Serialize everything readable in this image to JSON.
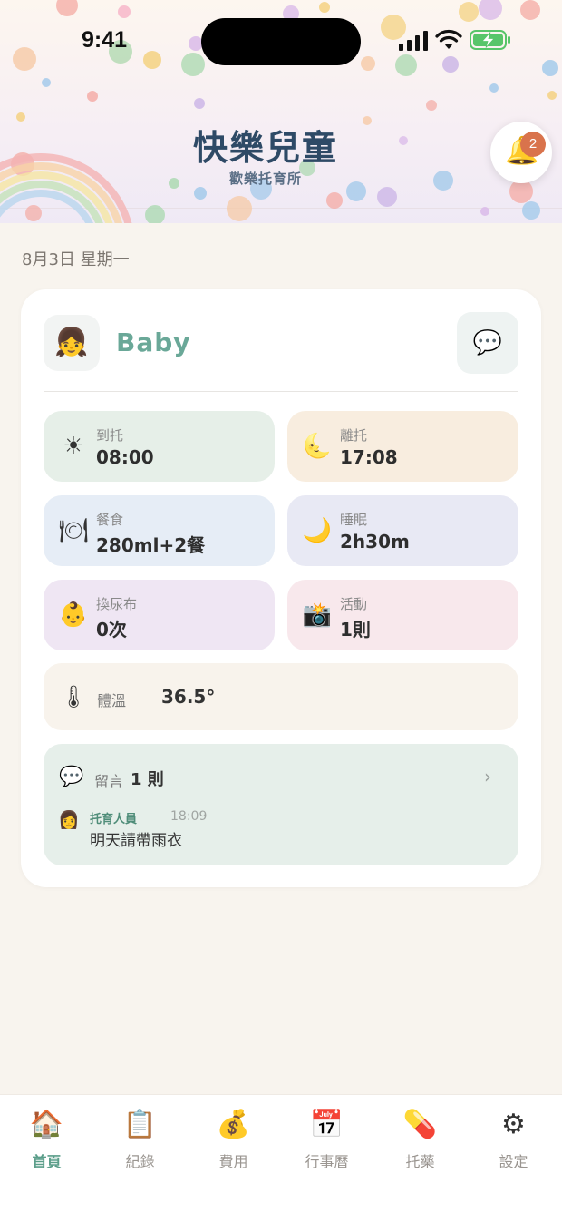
{
  "status_bar": {
    "time": "9:41"
  },
  "header": {
    "title": "快樂兒童",
    "subtitle": "歡樂托育所",
    "notification_count": "2"
  },
  "date": "8月3日 星期一",
  "child": {
    "name": "Baby"
  },
  "tiles": [
    {
      "label": "到托",
      "value": "08:00",
      "icon": "sun-icon"
    },
    {
      "label": "離托",
      "value": "17:08",
      "icon": "moon-face-icon"
    },
    {
      "label": "餐食",
      "value": "280ml+2餐",
      "icon": "plate-icon"
    },
    {
      "label": "睡眠",
      "value": "2h30m",
      "icon": "crescent-moon-icon"
    },
    {
      "label": "換尿布",
      "value": "0次",
      "icon": "baby-icon"
    },
    {
      "label": "活動",
      "value": "1則",
      "icon": "camera-flash-icon"
    }
  ],
  "temperature": {
    "label": "體溫",
    "value": "36.5°",
    "icon": "thermometer-icon"
  },
  "messages": {
    "label": "留言",
    "count": "1 則",
    "latest": {
      "author": "托育人員",
      "time": "18:09",
      "text": "明天請帶雨衣"
    }
  },
  "tabbar": [
    {
      "label": "首頁",
      "icon": "house-icon",
      "active": true
    },
    {
      "label": "紀錄",
      "icon": "clipboard-icon",
      "active": false
    },
    {
      "label": "費用",
      "icon": "money-bag-icon",
      "active": false
    },
    {
      "label": "行事曆",
      "icon": "calendar-icon",
      "active": false
    },
    {
      "label": "托藥",
      "icon": "pill-icon",
      "active": false
    },
    {
      "label": "設定",
      "icon": "gear-icon",
      "active": false
    }
  ],
  "colors": {
    "accent": "#5b9e8a",
    "title": "#2e4a66",
    "badge": "#d9734c",
    "tile_arrival": "#e6efe8",
    "tile_departure": "#f8eddf",
    "tile_meal": "#e6edf6",
    "tile_sleep": "#e8e9f4",
    "tile_diaper": "#efe6f3",
    "tile_activity": "#f8e8ec"
  }
}
